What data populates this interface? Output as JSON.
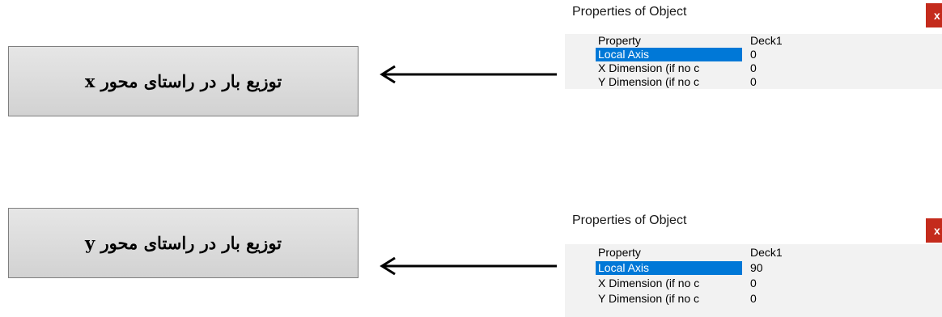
{
  "annotations": [
    {
      "label": "توزیع بار در راستای محور x"
    },
    {
      "label": "توزیع بار در راستای محور y"
    }
  ],
  "panels": [
    {
      "title": "Properties of Object",
      "close_glyph": "x",
      "header_key": "Property",
      "header_value": "Deck1",
      "rows": [
        {
          "key": "Local Axis",
          "value": "0"
        },
        {
          "key": "X Dimension (if no c",
          "value": "0"
        },
        {
          "key": "Y Dimension (if no c",
          "value": "0"
        }
      ]
    },
    {
      "title": "Properties of Object",
      "close_glyph": "x",
      "header_key": "Property",
      "header_value": "Deck1",
      "rows": [
        {
          "key": "Local Axis",
          "value": "90"
        },
        {
          "key": "X Dimension (if no c",
          "value": "0"
        },
        {
          "key": "Y Dimension (if no c",
          "value": "0"
        }
      ]
    }
  ],
  "colors": {
    "selection": "#0078d7",
    "close_button": "#c42b1c",
    "grid_background": "#f2f2f2"
  }
}
